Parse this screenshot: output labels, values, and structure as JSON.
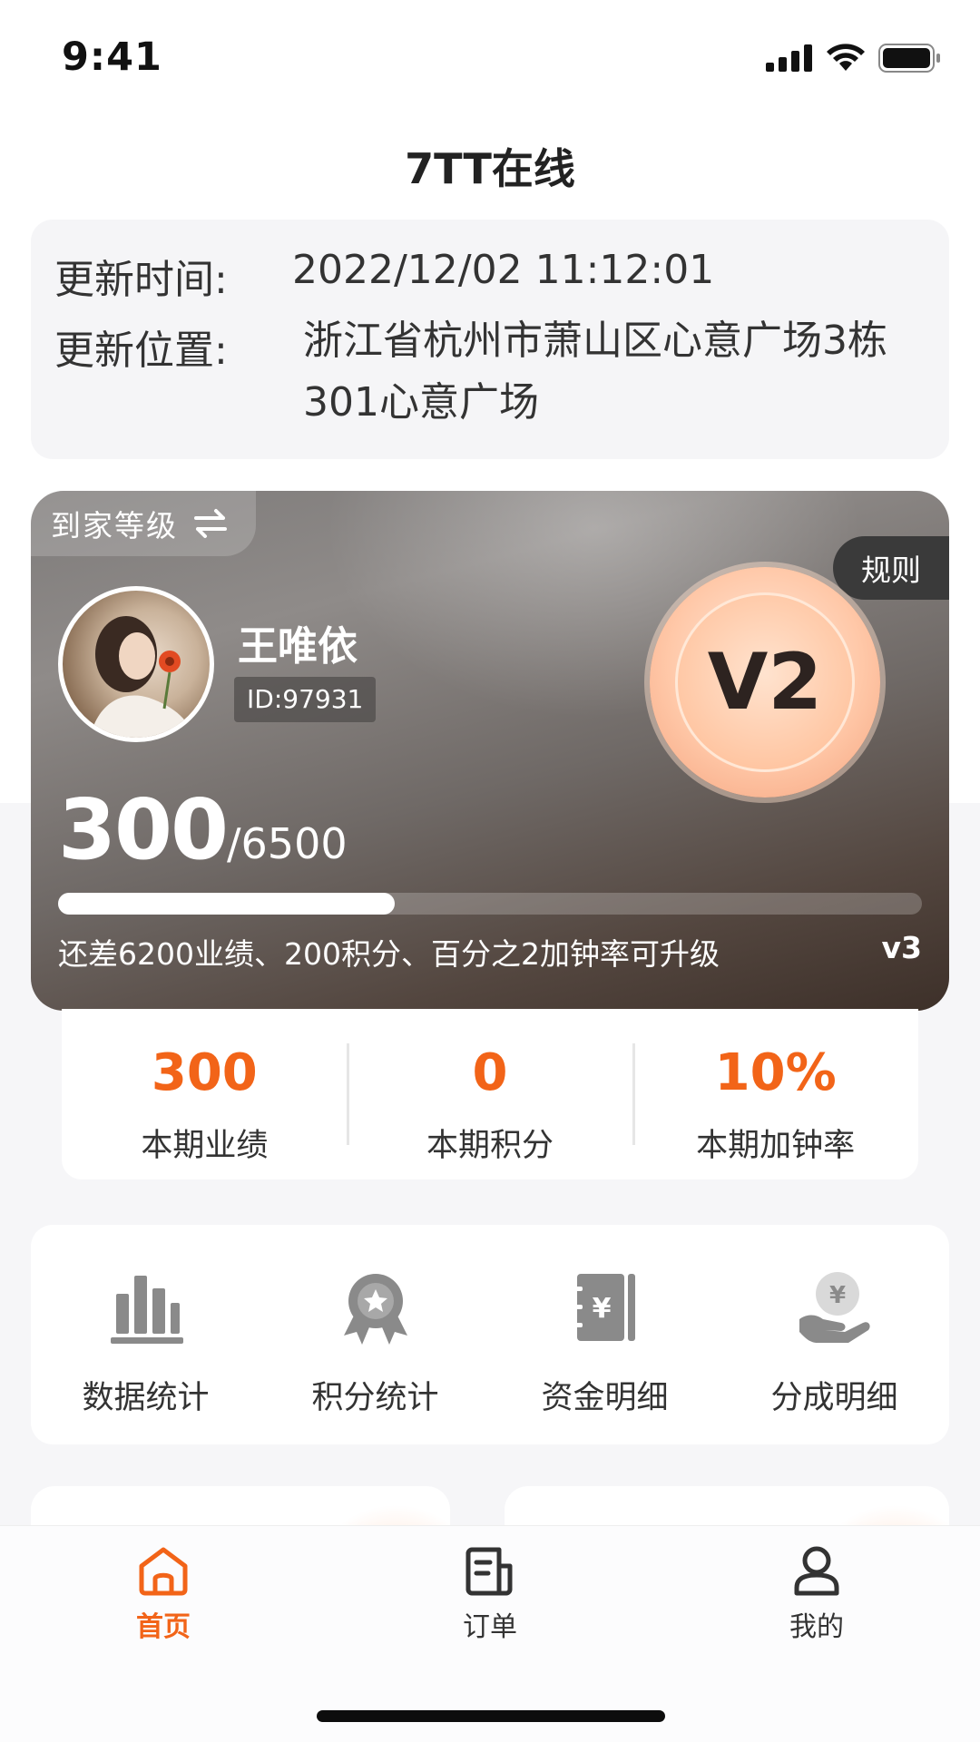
{
  "status_bar": {
    "time": "9:41"
  },
  "nav": {
    "title": "7TT在线"
  },
  "update_info": {
    "time_label": "更新时间:",
    "time_value": "2022/12/02  11:12:01",
    "location_label": "更新位置:",
    "location_value": "浙江省杭州市萧山区心意广场3栋301心意广场"
  },
  "level_card": {
    "tab_label": "到家等级",
    "rule_label": "规则",
    "user_name": "王唯依",
    "user_id": "ID:97931",
    "level_badge": "V2",
    "score_current": "300",
    "score_total": "/6500",
    "progress_fraction": 0.39,
    "upgrade_hint": "还差6200业绩、200积分、百分之2加钟率可升级",
    "next_level": "v3"
  },
  "stats": [
    {
      "value": "300",
      "label": "本期业绩"
    },
    {
      "value": "0",
      "label": "本期积分"
    },
    {
      "value": "10%",
      "label": "本期加钟率"
    }
  ],
  "tools": [
    {
      "label": "数据统计",
      "icon": "bar-chart-icon"
    },
    {
      "label": "积分统计",
      "icon": "medal-icon"
    },
    {
      "label": "资金明细",
      "icon": "ledger-icon"
    },
    {
      "label": "分成明细",
      "icon": "coin-hand-icon"
    }
  ],
  "tabbar": [
    {
      "label": "首页",
      "icon": "home-icon",
      "active": true
    },
    {
      "label": "订单",
      "icon": "order-icon",
      "active": false
    },
    {
      "label": "我的",
      "icon": "profile-icon",
      "active": false
    }
  ],
  "colors": {
    "accent": "#f26418",
    "card_dark": "#5a4a42",
    "medal": "#ffc39e"
  }
}
